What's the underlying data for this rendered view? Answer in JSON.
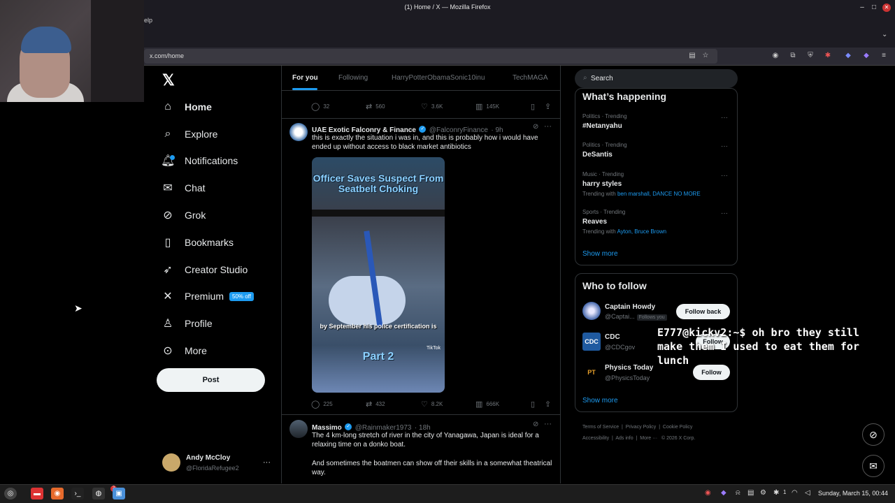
{
  "browser": {
    "window_title": "(1) Home / X — Mozilla Firefox",
    "menu_partial": "elp",
    "url": "x.com/home"
  },
  "nav": {
    "items": [
      {
        "label": "Home",
        "icon": "home-icon"
      },
      {
        "label": "Explore",
        "icon": "search-icon"
      },
      {
        "label": "Notifications",
        "icon": "bell-icon"
      },
      {
        "label": "Chat",
        "icon": "mail-icon"
      },
      {
        "label": "Grok",
        "icon": "grok-icon"
      },
      {
        "label": "Bookmarks",
        "icon": "bookmark-icon"
      },
      {
        "label": "Creator Studio",
        "icon": "rocket-icon"
      },
      {
        "label": "Premium",
        "icon": "x-icon"
      },
      {
        "label": "Profile",
        "icon": "person-icon"
      },
      {
        "label": "More",
        "icon": "more-circle-icon"
      }
    ],
    "premium_badge": "50% off",
    "post_label": "Post",
    "account": {
      "name": "Andy McCloy",
      "handle": "@FloridaRefugee2"
    }
  },
  "feed": {
    "tabs": [
      "For you",
      "Following",
      "HarryPotterObamaSonic10inu",
      "TechMAGA"
    ],
    "top_metrics": {
      "replies": "32",
      "reposts": "560",
      "likes": "3.6K",
      "views": "145K"
    },
    "tweets": [
      {
        "name": "UAE Exotic Falconry & Finance",
        "handle": "@FalconryFinance",
        "time": "· 9h",
        "text": "this is exactly the situation i was in, and this is probably how i would have ended up without access to black market antibiotics",
        "media": {
          "headline": "Officer Saves Suspect From Seatbelt Choking",
          "caption": "by September his police certification is",
          "part": "Part 2",
          "watermark": "TikTok"
        },
        "metrics": {
          "replies": "225",
          "reposts": "432",
          "likes": "8.2K",
          "views": "666K"
        }
      },
      {
        "name": "Massimo",
        "handle": "@Rainmaker1973",
        "time": "· 18h",
        "text": "The 4 km-long stretch of river in the city of Yanagawa, Japan is ideal for a relaxing time on a donko boat.",
        "text2": "And sometimes the boatmen can show off their skills in a somewhat theatrical way."
      }
    ]
  },
  "right": {
    "search_placeholder": "Search",
    "happening_title": "What’s happening",
    "trends": [
      {
        "meta": "Politics · Trending",
        "name": "#Netanyahu",
        "with": ""
      },
      {
        "meta": "Politics · Trending",
        "name": "DeSantis",
        "with": ""
      },
      {
        "meta": "Music · Trending",
        "name": "harry styles",
        "with_prefix": "Trending with",
        "with": "ben marshall, DANCE NO MORE"
      },
      {
        "meta": "Sports · Trending",
        "name": "Reaves",
        "with_prefix": "Trending with",
        "with": "Ayton, Bruce Brown"
      }
    ],
    "show_more": "Show more",
    "who_title": "Who to follow",
    "who": [
      {
        "name": "Captain Howdy",
        "handle": "@Captai...",
        "follows_you": "Follows you",
        "button": "Follow back"
      },
      {
        "name": "CDC",
        "handle": "@CDCgov",
        "button": "Follow"
      },
      {
        "name": "Physics Today",
        "handle": "@PhysicsToday",
        "button": "Follow"
      }
    ],
    "footer": [
      "Terms of Service",
      "Privacy Policy",
      "Cookie Policy",
      "Accessibility",
      "Ads info",
      "More ···",
      "© 2026 X Corp."
    ]
  },
  "overlay": {
    "prompt": "E777@kickv2:~$",
    "message": "oh bro they still make them I used to eat them for lunch"
  },
  "taskbar": {
    "clock": "Sunday, March 15, 00:44",
    "notif_count": "1",
    "app_badge": "2"
  },
  "colors": {
    "accent": "#1d9bf0",
    "background": "#000000",
    "text": "#e7e9ea",
    "muted": "#71767b"
  }
}
